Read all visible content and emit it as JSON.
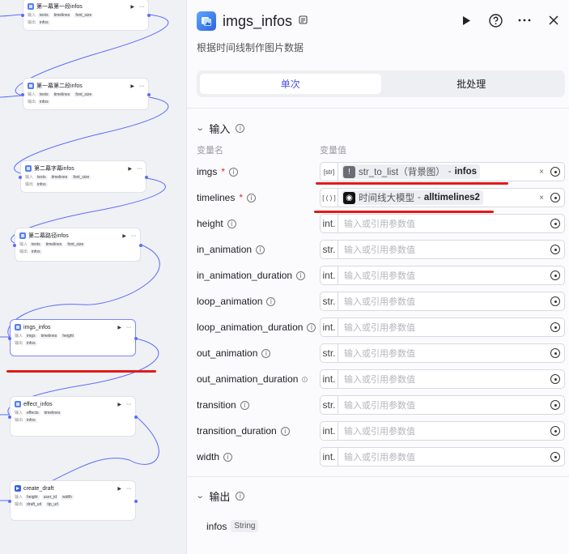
{
  "canvas": {
    "nodes": [
      {
        "title": "第一幕第一段infos",
        "params": [
          "texts",
          "timelines",
          "font_size"
        ],
        "out": [
          "infos"
        ],
        "in_label": "输入",
        "out_label": "输出"
      },
      {
        "title": "第一幕第二段infos",
        "params": [
          "texts",
          "timelines",
          "font_size"
        ],
        "out": [
          "infos"
        ],
        "in_label": "输入",
        "out_label": "输出"
      },
      {
        "title": "第二幕字幕infos",
        "params": [
          "texts",
          "timelines",
          "font_size"
        ],
        "out": [
          "infos"
        ],
        "in_label": "输入",
        "out_label": "输出"
      },
      {
        "title": "第二幕路径infos",
        "params": [
          "texts",
          "timelines",
          "font_size"
        ],
        "out": [
          "infos"
        ],
        "in_label": "输入",
        "out_label": "输出"
      },
      {
        "title": "imgs_infos",
        "params": [
          "imgs",
          "timelines",
          "height"
        ],
        "out": [
          "infos"
        ],
        "in_label": "输入",
        "out_label": "输出"
      },
      {
        "title": "effect_infos",
        "params": [
          "effects",
          "timelines"
        ],
        "out": [
          "infos"
        ],
        "in_label": "输入",
        "out_label": "输出"
      },
      {
        "title": "create_draft",
        "params": [
          "height",
          "user_id",
          "width"
        ],
        "out": [
          "draft_url",
          "tip_url"
        ],
        "in_label": "输入",
        "out_label": "输出"
      }
    ]
  },
  "panel": {
    "title": "imgs_infos",
    "description": "根据时间线制作图片数据",
    "tabs": [
      "单次",
      "批处理"
    ],
    "active_tab": 0,
    "input_section": "输入",
    "col_name": "变量名",
    "col_value": "变量值",
    "placeholder": "输入或引用参数值",
    "inputs": [
      {
        "name": "imgs",
        "required": true,
        "type": "[str]",
        "ref_node": "str_to_list（背景图）",
        "ref_sep": " - ",
        "ref_var": "infos"
      },
      {
        "name": "timelines",
        "required": true,
        "type": "[ ( ) ]",
        "ref_node": "时间线大模型",
        "ref_sep": " - ",
        "ref_var": "alltimelines2"
      },
      {
        "name": "height",
        "required": false,
        "type": "int."
      },
      {
        "name": "in_animation",
        "required": false,
        "type": "str."
      },
      {
        "name": "in_animation_duration",
        "required": false,
        "type": "int."
      },
      {
        "name": "loop_animation",
        "required": false,
        "type": "str."
      },
      {
        "name": "loop_animation_duration",
        "required": false,
        "type": "int."
      },
      {
        "name": "out_animation",
        "required": false,
        "type": "str."
      },
      {
        "name": "out_animation_duration",
        "required": false,
        "type": "int."
      },
      {
        "name": "transition",
        "required": false,
        "type": "str."
      },
      {
        "name": "transition_duration",
        "required": false,
        "type": "int."
      },
      {
        "name": "width",
        "required": false,
        "type": "int."
      }
    ],
    "output_section": "输出",
    "outputs": [
      {
        "name": "infos",
        "type": "String"
      }
    ]
  },
  "colors": {
    "accent": "#4d53e8",
    "annotation": "#e11a1a",
    "edge": "#5b6cf9"
  }
}
